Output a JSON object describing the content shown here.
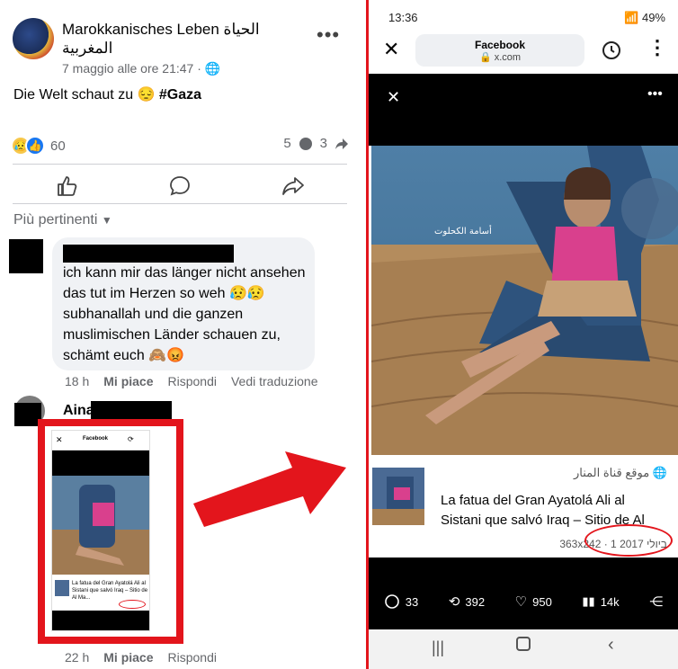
{
  "post": {
    "page_name": "Marokkanisches Leben الحياة المغربية",
    "meta": "7 maggio alle ore 21:47 · ",
    "text": "Die Welt schaut zu 😔 ",
    "hashtag": "#Gaza",
    "reaction_count": "60",
    "comment_count": "5",
    "share_count": "3"
  },
  "sort_label": "Più pertinenti",
  "comment1": {
    "text": "ich kann mir das länger nicht ansehen das tut im Herzen so weh 😥😥subhanallah und die ganzen muslimischen Länder schauen zu, schämt euch 🙈😡",
    "time": "18 h",
    "like": "Mi piace",
    "reply": "Rispondi",
    "translate": "Vedi traduzione"
  },
  "comment2": {
    "author": "Aina",
    "time": "22 h",
    "like": "Mi piace",
    "reply": "Rispondi"
  },
  "phone": {
    "time": "13:36",
    "battery": "49%",
    "browser_title": "Facebook",
    "browser_url": "x.com",
    "watermark": "أسامة الكحلوت",
    "card_source": "موقع قناة المنار",
    "card_title": "La fatua del Gran Ayatolá Ali al Sistani que salvó Iraq – Sitio de Al Ma...",
    "card_meta_size": "363x242 · ",
    "card_meta_date": "1 ביולי 2017",
    "stat_replies": "33",
    "stat_reposts": "392",
    "stat_likes": "950",
    "stat_views": "14k"
  },
  "thumb": {
    "title": "Facebook",
    "card_title": "La fatua del Gran Ayatolá Ali al Sistani que salvó Iraq – Sitio de Al Ma..."
  },
  "colors": {
    "highlight_red": "#e3151c",
    "facebook_blue": "#1877f2"
  }
}
